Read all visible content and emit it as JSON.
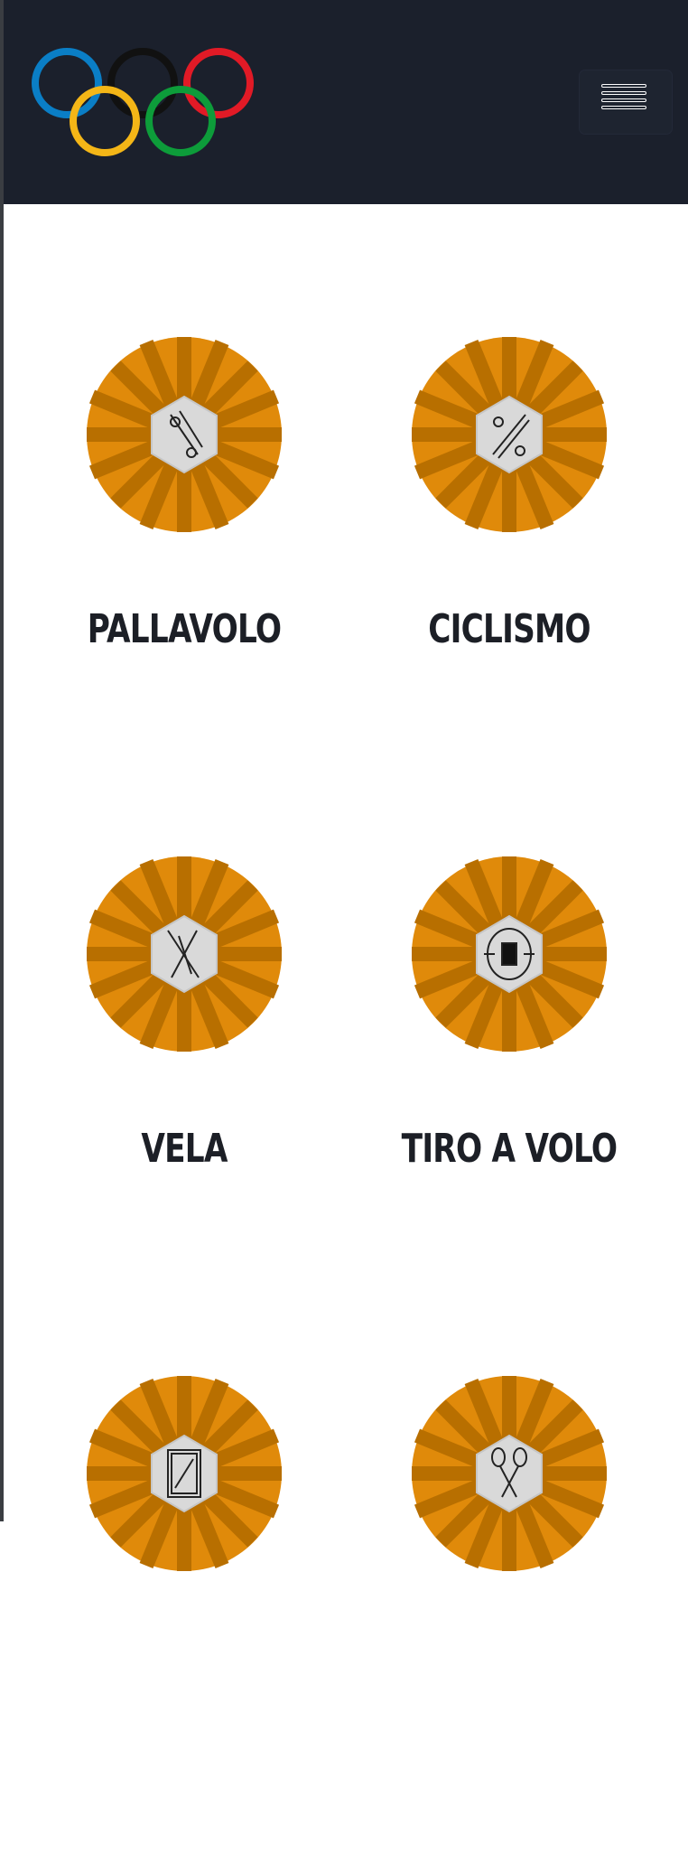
{
  "header": {
    "logo_name": "olympic-rings-logo",
    "ring_colors": [
      "#0a7ec6",
      "#f4b617",
      "#111111",
      "#0d9c3a",
      "#e11a26"
    ],
    "menu_icon": "hamburger-menu-icon",
    "background": "#1b202c"
  },
  "sports": [
    {
      "label": "PALLAVOLO",
      "icon": "volleyball-pictogram-icon"
    },
    {
      "label": "CICLISMO",
      "icon": "cycling-pictogram-icon"
    },
    {
      "label": "VELA",
      "icon": "sailing-pictogram-icon"
    },
    {
      "label": "TIRO A VOLO",
      "icon": "shooting-pictogram-icon"
    },
    {
      "label": "",
      "icon": "frame-pictogram-icon"
    },
    {
      "label": "",
      "icon": "racket-pictogram-icon"
    }
  ],
  "colors": {
    "medal_orange": "#e08a0a",
    "medal_dark": "#b86f00",
    "hex_face": "#d9d9d9",
    "label_text": "#1c1f26"
  }
}
